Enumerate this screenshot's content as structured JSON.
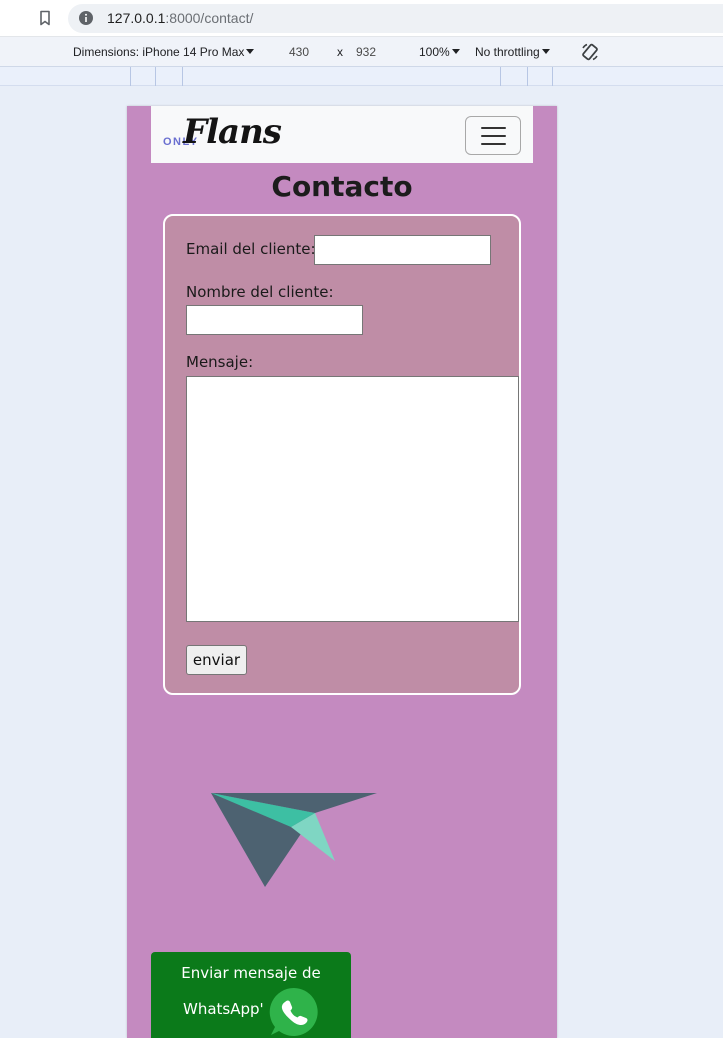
{
  "browser": {
    "url_host": "127.0.0.1",
    "url_path": ":8000/contact/"
  },
  "devtools": {
    "dimensions_label": "Dimensions: iPhone 14 Pro Max",
    "width": "430",
    "times": "x",
    "height": "932",
    "zoom": "100%",
    "throttling": "No throttling"
  },
  "navbar": {
    "brand_small": "ONLY",
    "brand_script": "Flans"
  },
  "page": {
    "title": "Contacto"
  },
  "form": {
    "email_label": "Email del cliente:",
    "email_value": "",
    "name_label": "Nombre del cliente:",
    "name_value": "",
    "message_label": "Mensaje:",
    "message_value": "",
    "submit_label": "enviar"
  },
  "whatsapp": {
    "line1": "Enviar mensaje de",
    "line2": "WhatsApp'"
  },
  "colors": {
    "page_bg": "#c48ac0",
    "card_bg": "#bf8da6",
    "whatsapp_green": "#0b7a1a",
    "plane_teal": "#3dbfa3",
    "plane_slate": "#4d6271"
  },
  "icons": [
    "bookmark-icon",
    "info-icon",
    "rotate-device-icon",
    "hamburger-menu-icon",
    "paper-plane-icon",
    "whatsapp-icon"
  ]
}
